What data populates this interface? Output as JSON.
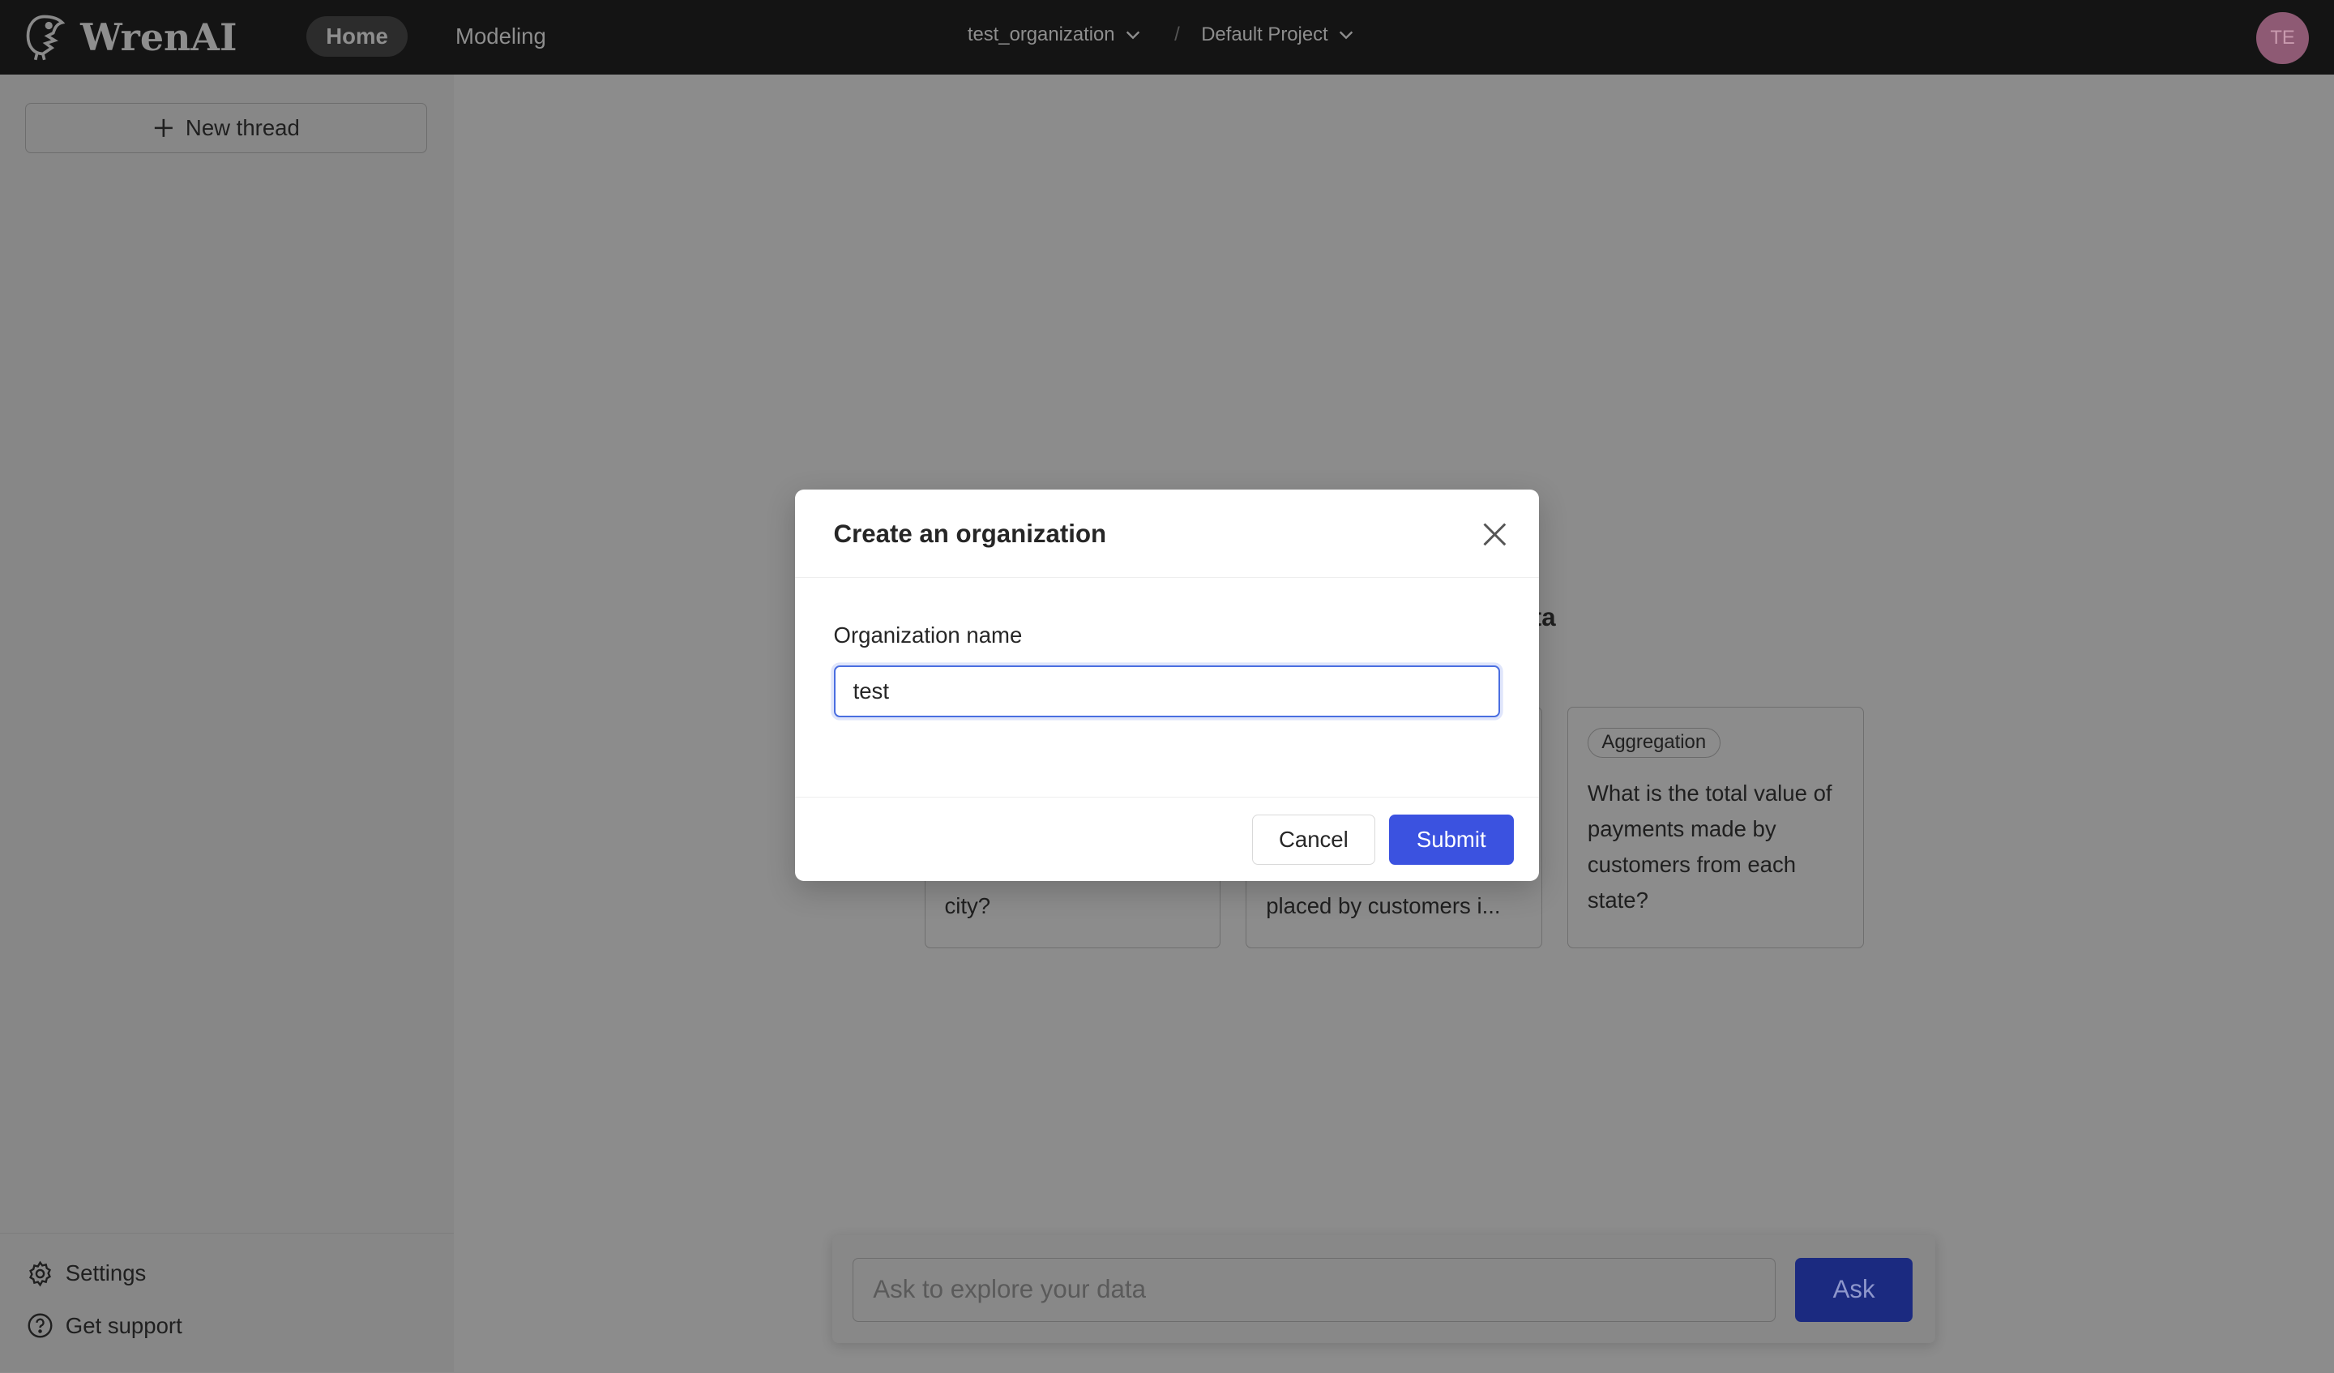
{
  "header": {
    "brand": "WrenAI",
    "nav": [
      {
        "label": "Home",
        "active": true
      },
      {
        "label": "Modeling",
        "active": false
      }
    ],
    "organization": "test_organization",
    "separator": "/",
    "project": "Default Project",
    "avatar_initials": "TE"
  },
  "sidebar": {
    "new_thread": "New thread",
    "settings": "Settings",
    "support": "Get support"
  },
  "main": {
    "heading_fragment": "ta",
    "cards": [
      {
        "text": "city?"
      },
      {
        "text": "placed by customers i..."
      },
      {
        "tag": "Aggregation",
        "text": "What is the total value of payments made by customers from each state?"
      }
    ],
    "ask_placeholder": "Ask to explore your data",
    "ask_button": "Ask"
  },
  "modal": {
    "title": "Create an organization",
    "field_label": "Organization name",
    "field_value": "test",
    "cancel": "Cancel",
    "submit": "Submit"
  },
  "colors": {
    "primary": "#3b52e0",
    "header_bg": "#141414"
  }
}
